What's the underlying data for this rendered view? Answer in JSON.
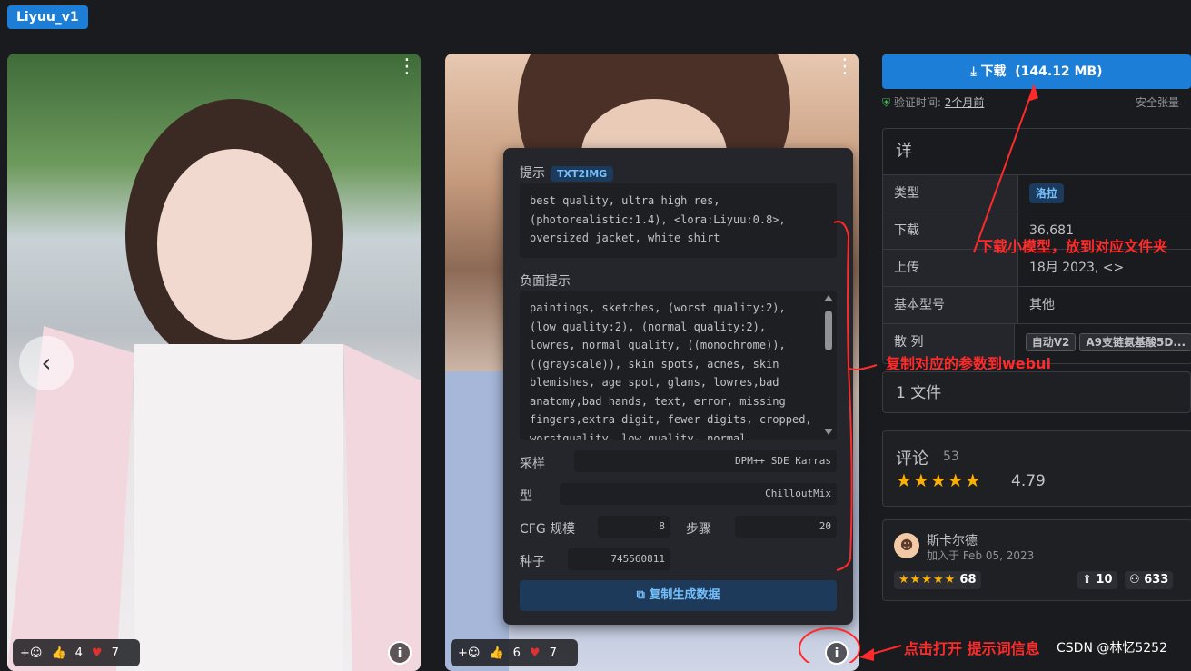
{
  "model_tag": "Liyuu_v1",
  "gallery": {
    "card1": {
      "reactions": {
        "like_count": "4",
        "heart_count": "7"
      }
    },
    "card2": {
      "reactions": {
        "like_count": "6",
        "heart_count": "7"
      }
    }
  },
  "popover": {
    "prompt_label": "提示",
    "mode_badge": "TXT2IMG",
    "prompt_text": "best quality, ultra high res, (photorealistic:1.4), <lora:Liyuu:0.8>, oversized jacket, white shirt",
    "negative_label": "负面提示",
    "negative_text": "paintings, sketches, (worst quality:2), (low quality:2), (normal quality:2), lowres, normal quality, ((monochrome)), ((grayscale)), skin spots, acnes, skin blemishes, age spot, glans, lowres,bad anatomy,bad hands, text, error, missing fingers,extra digit, fewer digits, cropped, worstquality, low quality, normal",
    "sampler_label": "采样",
    "sampler_value": "DPM++ SDE Karras",
    "model_label": "型",
    "model_value": "ChilloutMix",
    "cfg_label": "CFG 规模",
    "cfg_value": "8",
    "steps_label": "步骤",
    "steps_value": "20",
    "seed_label": "种子",
    "seed_value": "745560811",
    "copy_button": "复制生成数据"
  },
  "sidebar": {
    "download_label": "下载",
    "download_size": "(144.12 MB)",
    "verify_label": "验证时间:",
    "verify_time": "2个月前",
    "safety_label": "安全张量",
    "details_title": "详",
    "details": {
      "type_key": "类型",
      "type_value": "洛拉",
      "downloads_key": "下载",
      "downloads_value": "36,681",
      "uploaded_key": "上传",
      "uploaded_value": "18月 2023,  <>",
      "base_key": "基本型号",
      "base_value": "其他",
      "hash_key": "散 列",
      "hash_tag1": "自动V2",
      "hash_tag2": "A9支链氨基酸5D..."
    },
    "files_label": "1 文件",
    "reviews": {
      "label": "评论",
      "count": "53",
      "rating": "4.79",
      "stars": "★★★★★"
    },
    "creator": {
      "name": "斯卡尔德",
      "joined": "加入于 Feb 05, 2023",
      "stars": "★★★★★",
      "rating_count": "68",
      "uploads": "10",
      "followers": "633"
    }
  },
  "annotations": {
    "download_note": "下载小模型，放到对应文件夹",
    "copy_note": "复制对应的参数到webui",
    "info_note": "点击打开 提示词信息"
  },
  "watermark": "CSDN @林忆5252",
  "colors": {
    "accent": "#1c7ed6",
    "annotation": "#ff2a2a",
    "star": "#fab005"
  }
}
